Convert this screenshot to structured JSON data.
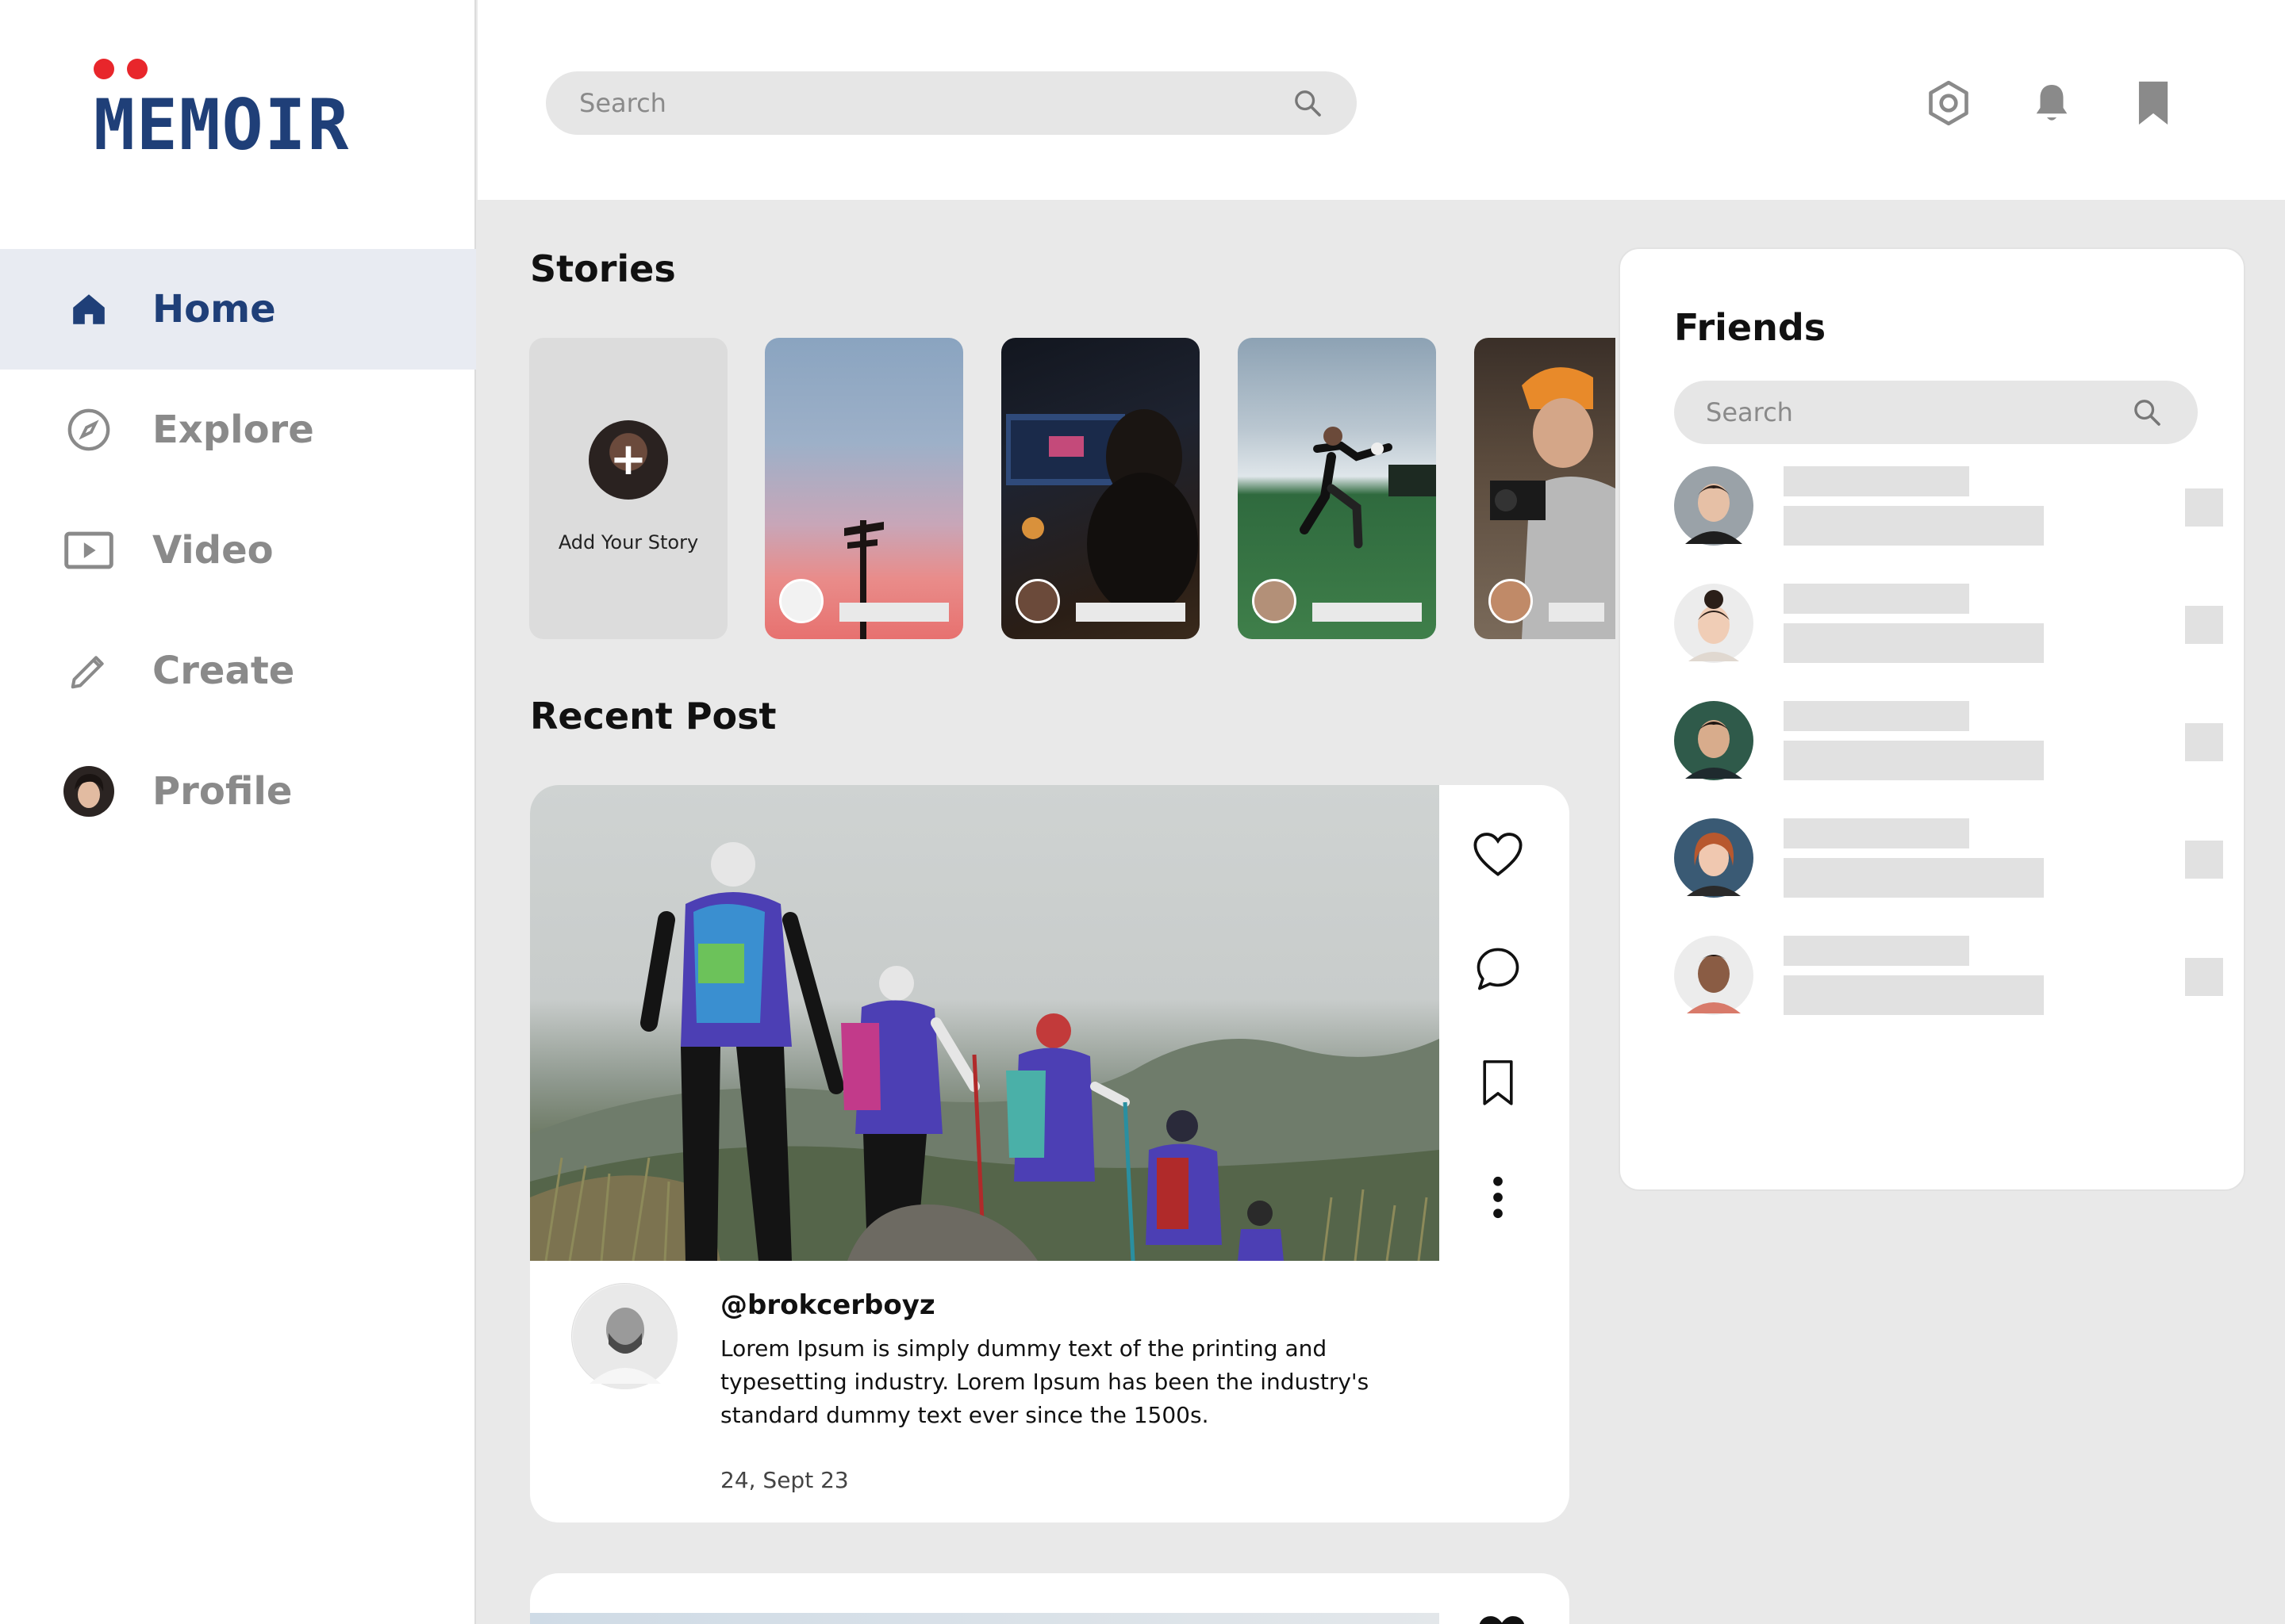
{
  "brand": {
    "name": "MEMOIR",
    "accent": "#1f3f78",
    "dot_color": "#e8262b"
  },
  "sidebar": {
    "items": [
      {
        "label": "Home",
        "icon": "home-icon",
        "active": true
      },
      {
        "label": "Explore",
        "icon": "compass-icon",
        "active": false
      },
      {
        "label": "Video",
        "icon": "video-icon",
        "active": false
      },
      {
        "label": "Create",
        "icon": "pencil-icon",
        "active": false
      },
      {
        "label": "Profile",
        "icon": "avatar",
        "active": false
      }
    ]
  },
  "header": {
    "search_placeholder": "Search",
    "icons": [
      "settings-hexagon-icon",
      "bell-icon",
      "bookmark-icon"
    ]
  },
  "stories": {
    "title": "Stories",
    "add_label": "Add Your Story",
    "items": [
      {
        "scene": "sunset-signpost"
      },
      {
        "scene": "editing-desk"
      },
      {
        "scene": "football-kick"
      },
      {
        "scene": "cameraman"
      }
    ]
  },
  "recent_post": {
    "title": "Recent Post",
    "username": "@brokcerboyz",
    "text": "Lorem Ipsum is simply dummy text of the printing and typesetting industry. Lorem Ipsum has been the industry's standard dummy text ever since the 1500s.",
    "date": "24, Sept 23",
    "actions": [
      "heart-icon",
      "comment-icon",
      "bookmark-icon",
      "more-vertical-icon"
    ]
  },
  "friends": {
    "title": "Friends",
    "search_placeholder": "Search",
    "count": 5
  }
}
